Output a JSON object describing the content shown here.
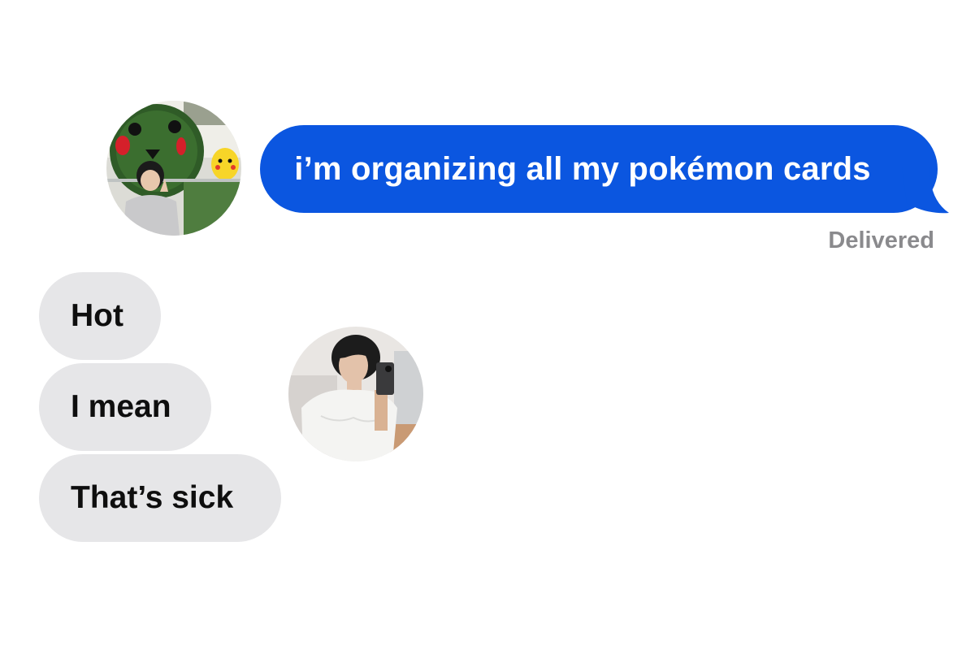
{
  "conversation": {
    "outgoing": [
      {
        "text": "i’m organizing all my pokémon cards"
      }
    ],
    "status": "Delivered",
    "incoming": [
      {
        "text": "Hot"
      },
      {
        "text": "I mean"
      },
      {
        "text": "That’s sick"
      }
    ]
  },
  "avatars": {
    "sender": {
      "icon": "contact-photo-icon"
    },
    "replier": {
      "icon": "contact-photo-icon"
    }
  },
  "colors": {
    "outgoing_bubble": "#0b56e0",
    "incoming_bubble": "#e6e6e8",
    "status_text": "#8a8a8d",
    "background": "#ffffff"
  }
}
